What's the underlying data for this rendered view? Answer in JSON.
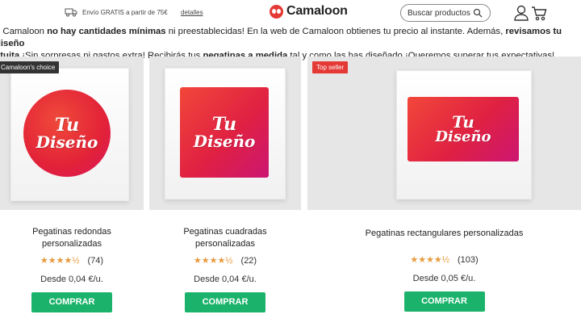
{
  "header": {
    "shipping_text": "Envío GRATIS a partir de 75€",
    "details_link": "detalles",
    "logo_text": "Camaloon",
    "search_placeholder": "Buscar productos"
  },
  "intro": {
    "p1_start": "n Camaloon ",
    "p1_bold1": "no hay cantidades mínimas",
    "p1_mid": " ni preestablecidas! En la web de Camaloon obtienes tu precio al instante. Además, ",
    "p1_bold2": "revisamos tu diseño",
    "p2_bold1": "atuita",
    "p2_mid": " ¡Sin sorpresas ni gastos extra! Recibirás tus ",
    "p2_bold2": "pegatinas a medida",
    "p2_end": " tal y como las has diseñado ¡Queremos superar tus expectativas!"
  },
  "products": [
    {
      "badge": "Camaloon's choice",
      "sticker_line1": "Tu",
      "sticker_line2": "Diseño",
      "title_line1": "Pegatinas redondas",
      "title_line2": "personalizadas",
      "stars": "★★★★½",
      "rating": 4.5,
      "reviews": "(74)",
      "price": "Desde 0,04 €/u.",
      "button": "COMPRAR"
    },
    {
      "badge": "",
      "sticker_line1": "Tu",
      "sticker_line2": "Diseño",
      "title_line1": "Pegatinas cuadradas",
      "title_line2": "personalizadas",
      "stars": "★★★★½",
      "rating": 4.5,
      "reviews": "(22)",
      "price": "Desde 0,04 €/u.",
      "button": "COMPRAR"
    },
    {
      "badge": "Top seller",
      "sticker_line1": "Tu",
      "sticker_line2": "Diseño",
      "title_line1": "Pegatinas rectangulares personalizadas",
      "title_line2": "",
      "stars": "★★★★½",
      "rating": 4.5,
      "reviews": "(103)",
      "price": "Desde 0,05 €/u.",
      "button": "COMPRAR"
    }
  ],
  "colors": {
    "brand_red": "#e53935",
    "buy_green": "#1bb36b",
    "star_orange": "#e89a3c"
  }
}
